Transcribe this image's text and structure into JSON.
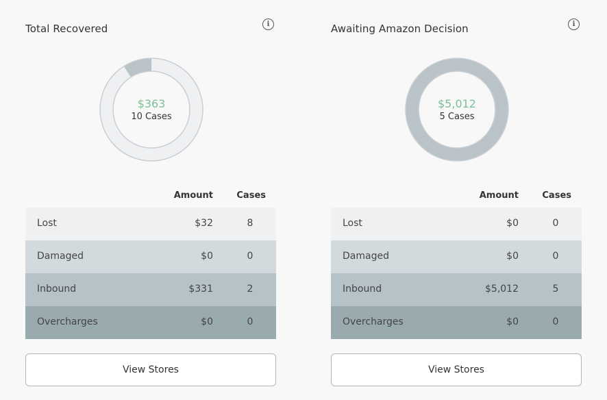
{
  "colors": {
    "accent_green": "#7cbf96",
    "ring_light": "#eef0f2",
    "ring_dark": "#b9c3c8",
    "ring_border": "#c9ced3",
    "row_lost": "#eef0f1",
    "row_damaged": "#d3dadd",
    "row_inbound": "#b5c2c7",
    "row_overcharges": "#9aabb0"
  },
  "cards": [
    {
      "title": "Total Recovered",
      "info_icon": "info-icon",
      "donut": {
        "amount": "$363",
        "cases": "10 Cases",
        "fraction_dark": 0.09
      },
      "table": {
        "headers": {
          "amount": "Amount",
          "cases": "Cases"
        },
        "rows": [
          {
            "label": "Lost",
            "amount": "$32",
            "cases": "8"
          },
          {
            "label": "Damaged",
            "amount": "$0",
            "cases": "0"
          },
          {
            "label": "Inbound",
            "amount": "$331",
            "cases": "2"
          },
          {
            "label": "Overcharges",
            "amount": "$0",
            "cases": "0"
          }
        ]
      },
      "button_label": "View Stores"
    },
    {
      "title": "Awaiting Amazon Decision",
      "info_icon": "info-icon",
      "donut": {
        "amount": "$5,012",
        "cases": "5 Cases",
        "fraction_dark": 1.0
      },
      "table": {
        "headers": {
          "amount": "Amount",
          "cases": "Cases"
        },
        "rows": [
          {
            "label": "Lost",
            "amount": "$0",
            "cases": "0"
          },
          {
            "label": "Damaged",
            "amount": "$0",
            "cases": "0"
          },
          {
            "label": "Inbound",
            "amount": "$5,012",
            "cases": "5"
          },
          {
            "label": "Overcharges",
            "amount": "$0",
            "cases": "0"
          }
        ]
      },
      "button_label": "View Stores"
    }
  ]
}
